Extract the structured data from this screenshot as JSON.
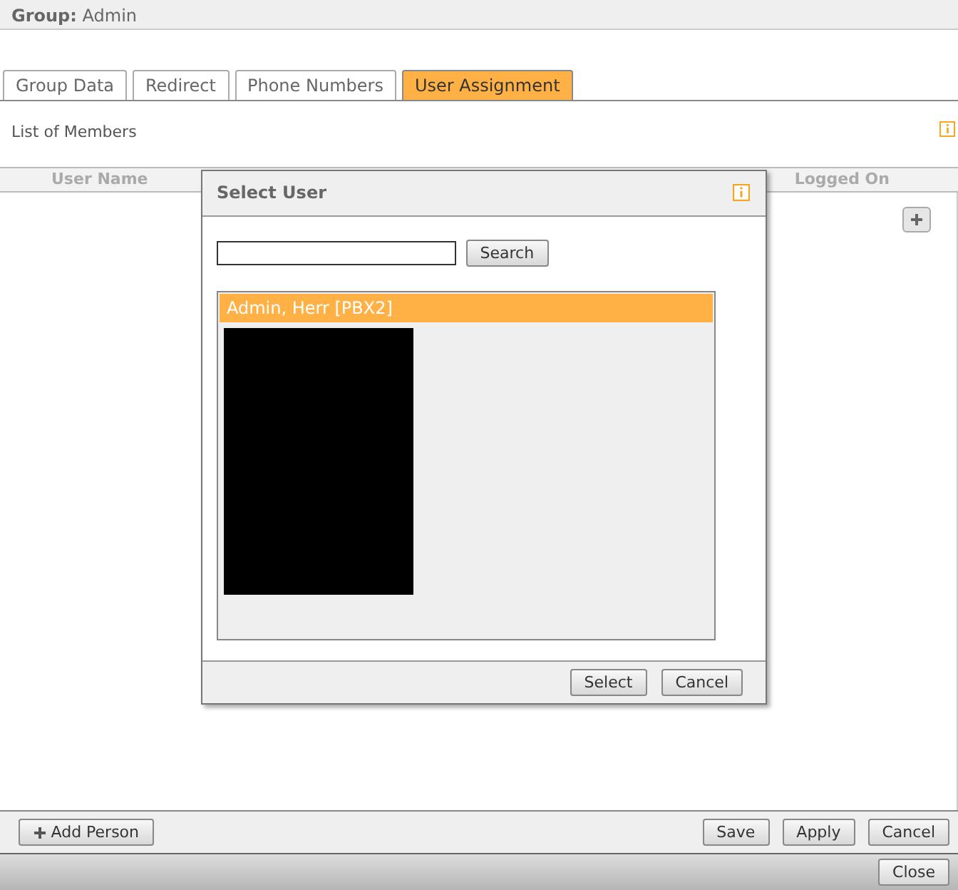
{
  "header": {
    "label": "Group:",
    "value": "Admin"
  },
  "tabs": [
    {
      "label": "Group Data",
      "selected": false
    },
    {
      "label": "Redirect",
      "selected": false
    },
    {
      "label": "Phone Numbers",
      "selected": false
    },
    {
      "label": "User Assignment",
      "selected": true
    }
  ],
  "section_title": "List of Members",
  "table": {
    "columns": [
      "User Name",
      "Logged On"
    ]
  },
  "dialog": {
    "title": "Select User",
    "search_button": "Search",
    "users": [
      {
        "label": "Admin, Herr [PBX2]",
        "selected": true
      }
    ],
    "buttons": [
      "Select",
      "Cancel"
    ]
  },
  "action_bar": {
    "add_button": "Add Person",
    "buttons": [
      "Save",
      "Apply",
      "Cancel"
    ]
  },
  "footer": {
    "close_button": "Close"
  }
}
